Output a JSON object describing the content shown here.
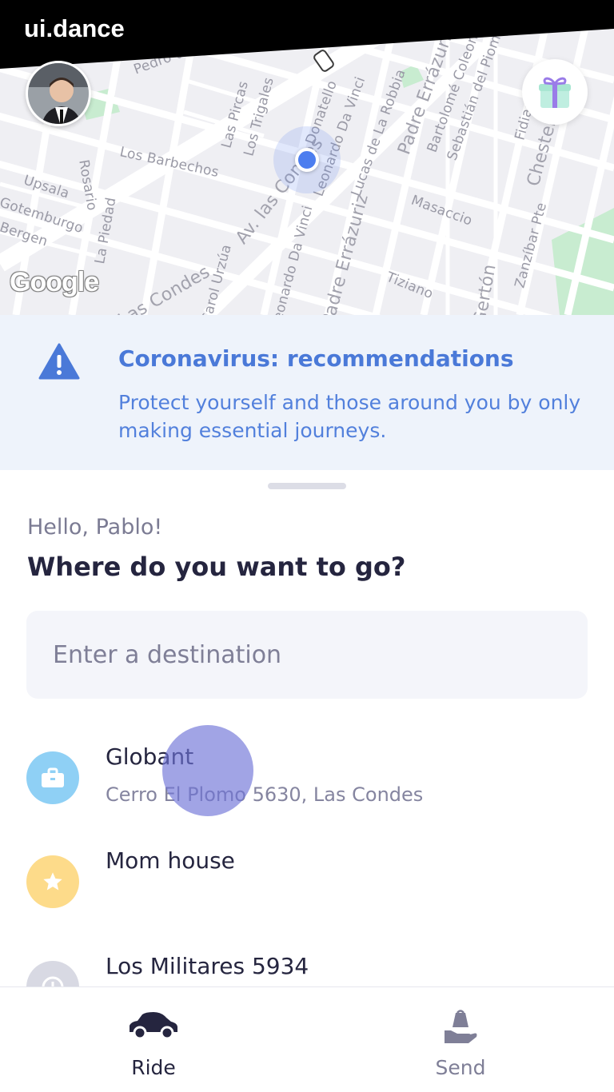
{
  "watermark": {
    "text": "ui.dance"
  },
  "map": {
    "attribution": "Google",
    "street_labels": [
      "Pedro de",
      "Rosario",
      "Los Barbechos",
      "Upsala",
      "Gotemburgo",
      "Bergen",
      "Las Pircas",
      "Los Trigales",
      "La Piedad",
      "Av. las Condes",
      "Las Condes",
      "Carol Urzúa",
      "Leonardo Da Vinci",
      "Donatello",
      "Lucas de La Robbia",
      "Padre Errázuriz",
      "Bartolomé Coleoni",
      "Sebastián del Piombo",
      "Masaccio",
      "Tiziano",
      "Fidias",
      "Chesterton",
      "Zanzíbar Pte",
      "Leonardo Da Vinci",
      "Padre Errázuriz",
      "Gertón"
    ],
    "colors": {
      "background": "#efeff3",
      "streets": "#ffffff",
      "parks": "#c8ecd0",
      "location": "#4d7eef"
    }
  },
  "profile": {
    "avatar_icon": "user-avatar"
  },
  "gift": {
    "icon": "gift-icon"
  },
  "banner": {
    "title": "Coronavirus: recommendations",
    "text": "Protect yourself and those around you by only making essential journeys.",
    "icon": "warning-icon",
    "colors": {
      "background": "#eef3fb",
      "accent": "#4a79d8"
    }
  },
  "sheet": {
    "greeting": "Hello, Pablo!",
    "headline": "Where do you want to go?",
    "search": {
      "placeholder": "Enter a destination",
      "value": ""
    }
  },
  "places": [
    {
      "name": "Globant",
      "address": "Cerro El Plomo 5630, Las Condes",
      "icon": "briefcase-icon",
      "color": "#8fd0f5"
    },
    {
      "name": "Mom house",
      "address": "",
      "icon": "star-icon",
      "color": "#fddb8a"
    },
    {
      "name": "Los Militares 5934",
      "address": "",
      "icon": "clock-icon",
      "color": "#d8d9e3"
    }
  ],
  "nav": {
    "tabs": [
      {
        "label": "Ride",
        "icon": "car-icon",
        "active": true
      },
      {
        "label": "Send",
        "icon": "package-hand-icon",
        "active": false
      }
    ],
    "colors": {
      "active": "#25253f",
      "inactive": "#7f7f97"
    }
  }
}
